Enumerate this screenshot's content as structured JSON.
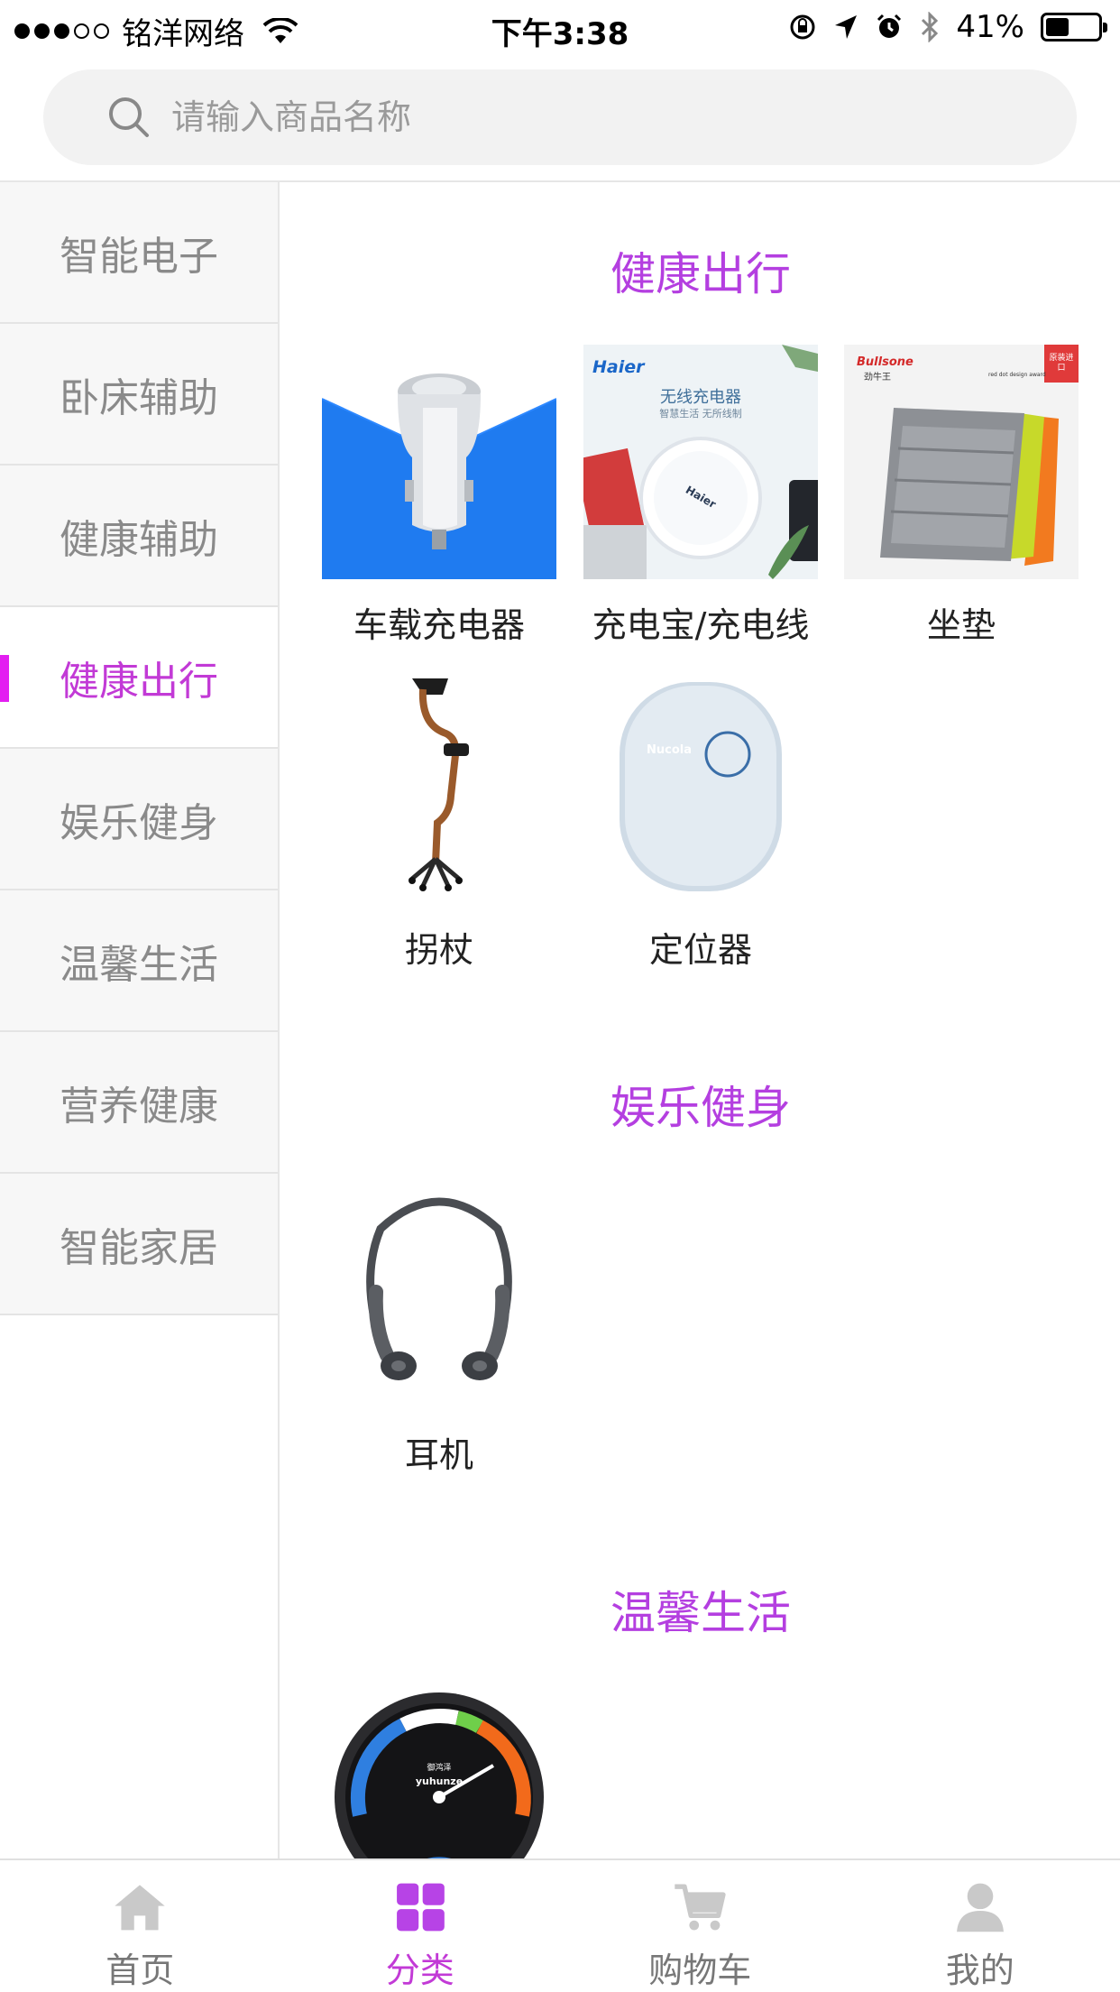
{
  "status_bar": {
    "carrier": "铭洋网络",
    "time": "下午3:38",
    "battery": "41%",
    "battery_level": 0.41
  },
  "search": {
    "placeholder": "请输入商品名称"
  },
  "sidebar": {
    "items": [
      {
        "label": "智能电子"
      },
      {
        "label": "卧床辅助"
      },
      {
        "label": "健康辅助"
      },
      {
        "label": "健康出行",
        "active": true
      },
      {
        "label": "娱乐健身"
      },
      {
        "label": "温馨生活"
      },
      {
        "label": "营养健康"
      },
      {
        "label": "智能家居"
      }
    ]
  },
  "content": {
    "sections": [
      {
        "title": "健康出行",
        "products": [
          {
            "name": "车载充电器",
            "icon": "car-charger-image"
          },
          {
            "name": "充电宝/充电线",
            "icon": "wireless-charger-image",
            "brand": "Haier",
            "caption": "无线充电器",
            "sub_caption": "智慧生活 无所线制"
          },
          {
            "name": "坐垫",
            "icon": "seat-cushion-image",
            "brand": "Bullsone",
            "brand_cn": "劲牛王",
            "award": "red dot design award",
            "badge": "原装进口"
          },
          {
            "name": "拐杖",
            "icon": "walking-cane-image"
          },
          {
            "name": "定位器",
            "icon": "gps-locator-image",
            "brand": "Nucola"
          }
        ]
      },
      {
        "title": "娱乐健身",
        "products": [
          {
            "name": "耳机",
            "icon": "headphones-image"
          }
        ]
      },
      {
        "title": "温馨生活",
        "products": [
          {
            "name": "",
            "icon": "thermometer-image",
            "brand": "yuhunze",
            "brand_cn": "御鸿泽"
          }
        ]
      }
    ]
  },
  "tab_bar": {
    "tabs": [
      {
        "label": "首页",
        "icon": "home-icon"
      },
      {
        "label": "分类",
        "icon": "category-icon",
        "active": true
      },
      {
        "label": "购物车",
        "icon": "cart-icon"
      },
      {
        "label": "我的",
        "icon": "user-icon"
      }
    ]
  },
  "colors": {
    "accent": "#b43fe0",
    "indicator": "#e31ef1",
    "sidebar_bg": "#f7f7f7",
    "inactive_text": "#8a8a8a"
  }
}
